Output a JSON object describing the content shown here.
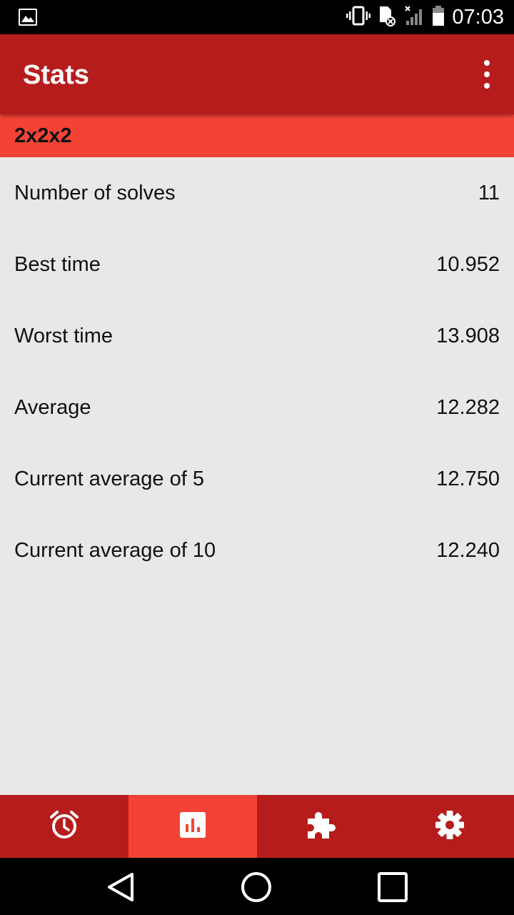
{
  "status_bar": {
    "time": "07:03",
    "icons": [
      "gallery-icon",
      "vibrate-icon",
      "sd-card-icon",
      "signal-icon",
      "battery-icon"
    ]
  },
  "app_bar": {
    "title": "Stats",
    "overflow_icon": "more-vert-icon"
  },
  "section": {
    "title": "2x2x2"
  },
  "stats": [
    {
      "label": "Number of solves",
      "value": "11"
    },
    {
      "label": "Best time",
      "value": "10.952"
    },
    {
      "label": "Worst time",
      "value": "13.908"
    },
    {
      "label": "Average",
      "value": "12.282"
    },
    {
      "label": "Current average of 5",
      "value": "12.750"
    },
    {
      "label": "Current average of 10",
      "value": "12.240"
    }
  ],
  "bottom_nav": {
    "items": [
      {
        "icon": "alarm-clock-icon",
        "active": false
      },
      {
        "icon": "bar-chart-icon",
        "active": true
      },
      {
        "icon": "puzzle-icon",
        "active": false
      },
      {
        "icon": "gear-icon",
        "active": false
      }
    ]
  },
  "colors": {
    "primary_dark": "#b71c1c",
    "accent": "#f44336",
    "background": "#e8e8e8"
  }
}
